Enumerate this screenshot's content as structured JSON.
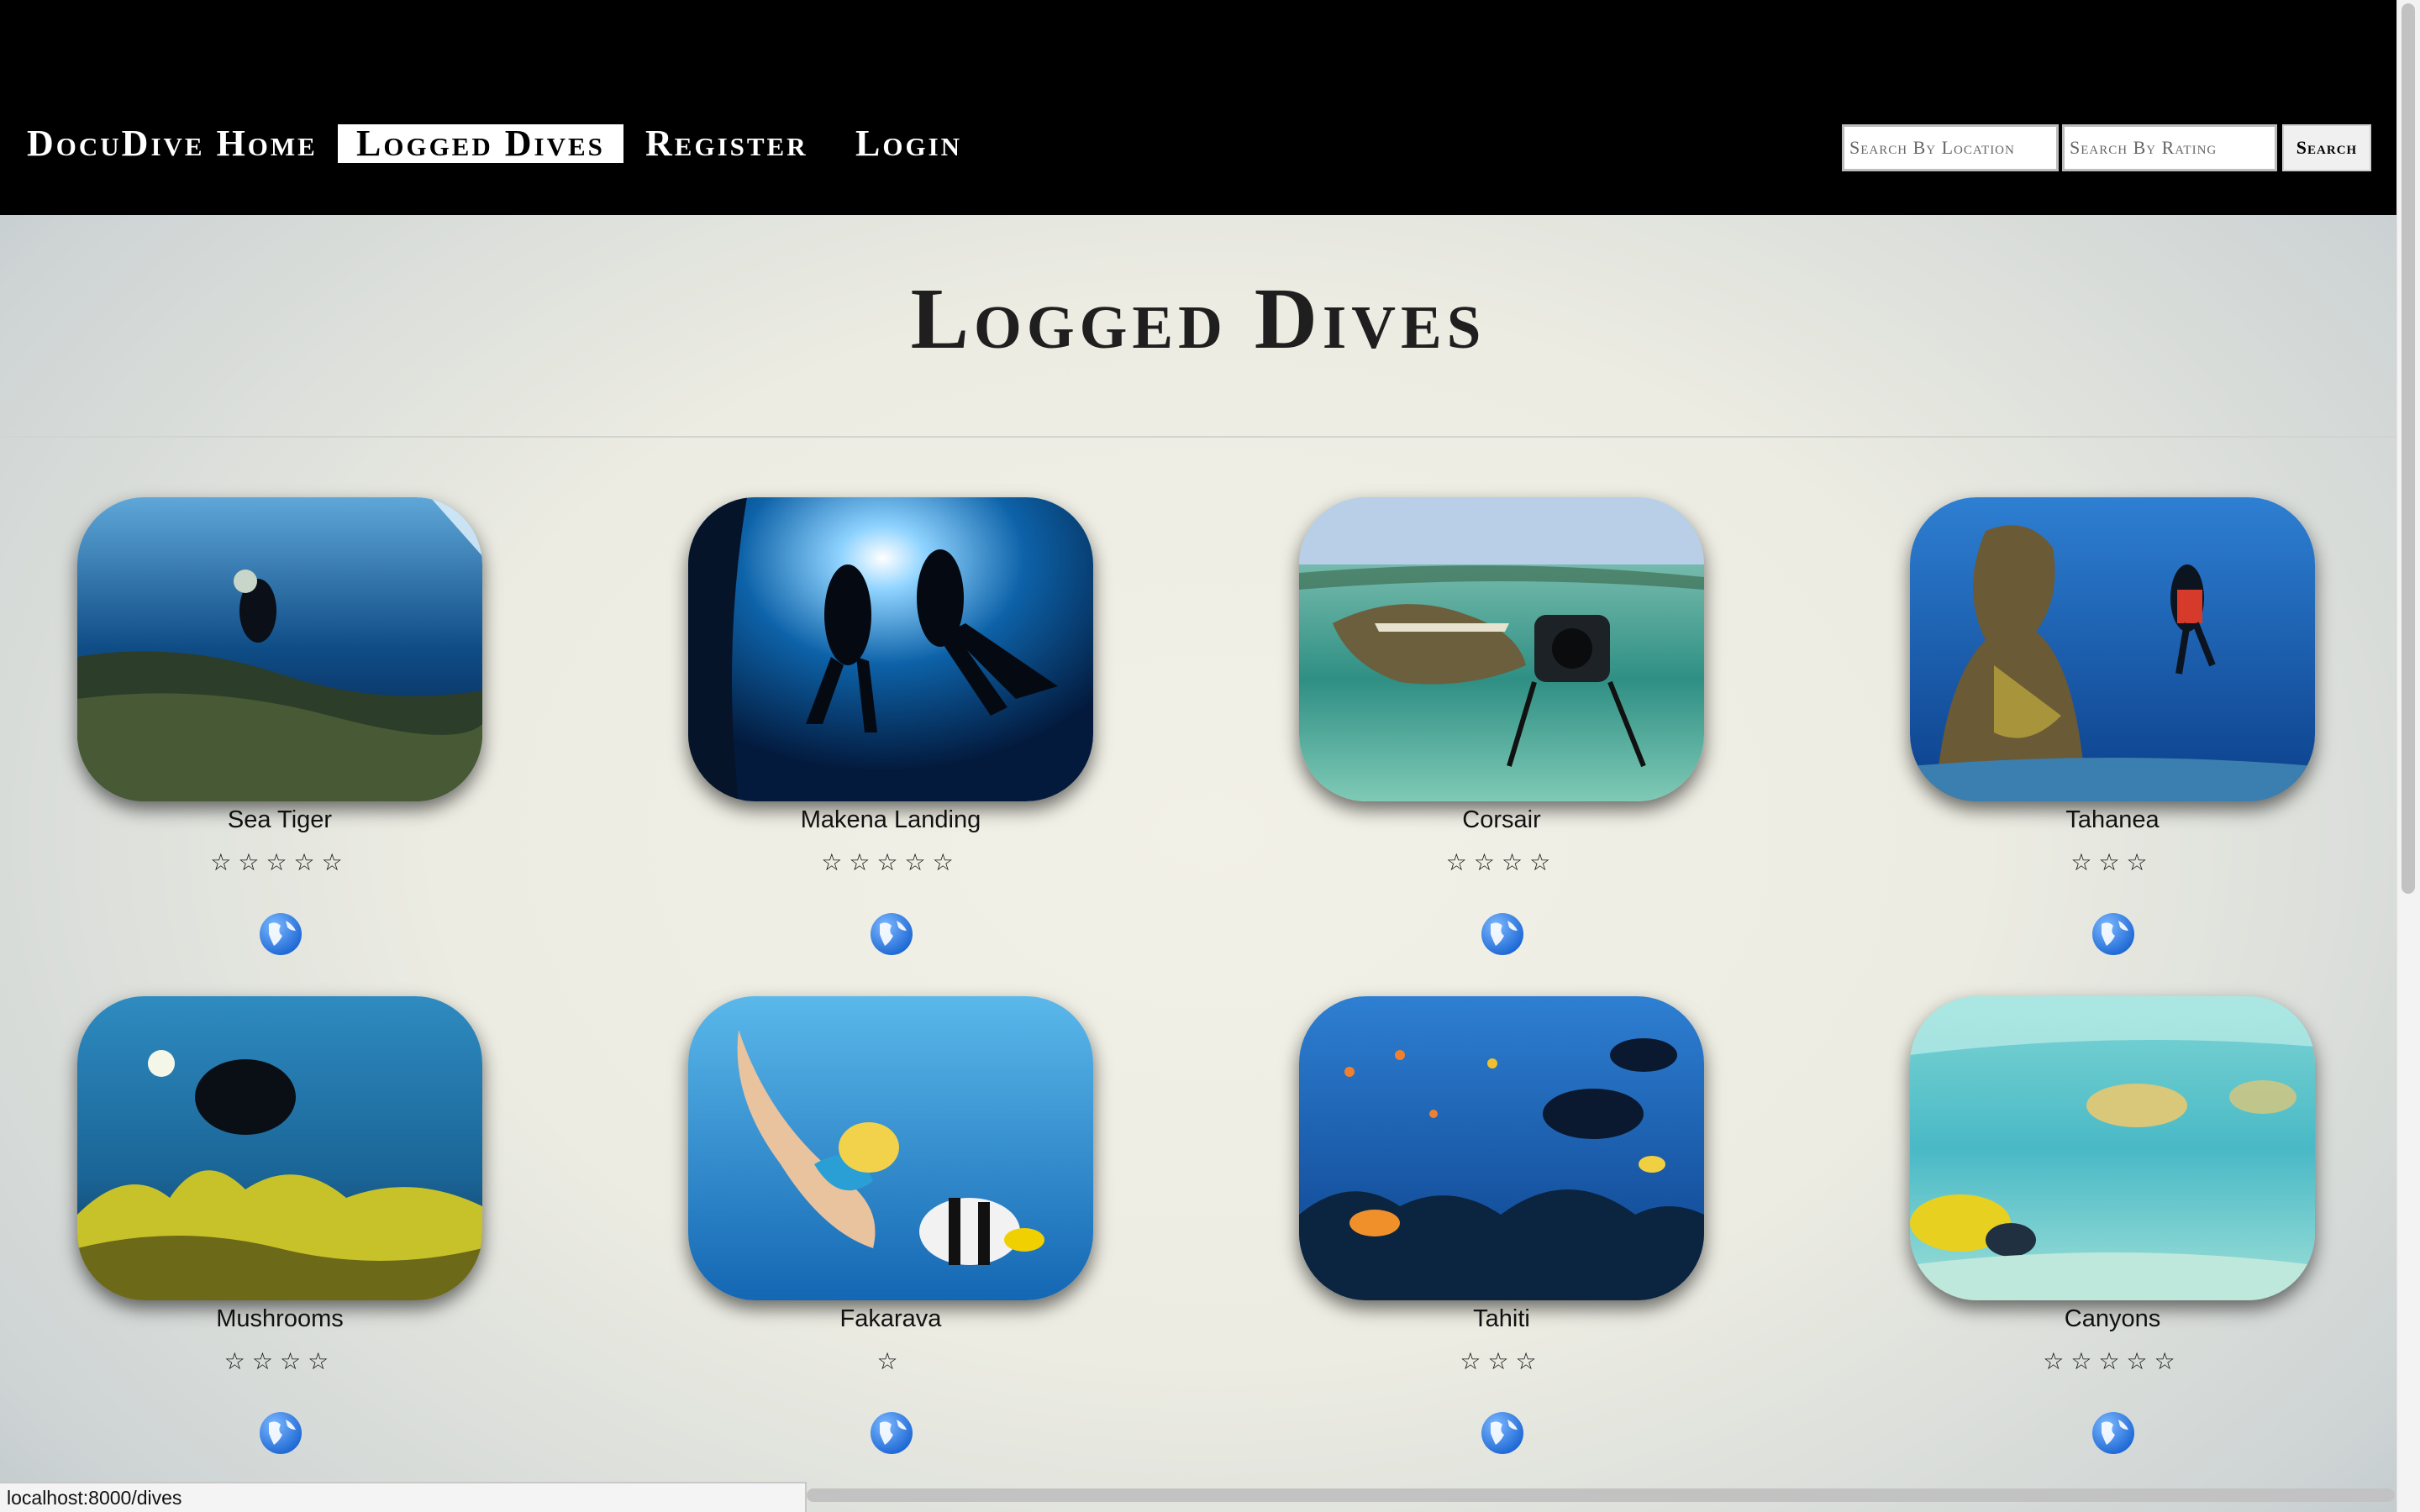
{
  "nav": {
    "links": [
      {
        "label": "DocuDive Home",
        "active": false
      },
      {
        "label": "Logged Dives",
        "active": true
      },
      {
        "label": "Register",
        "active": false
      },
      {
        "label": "Login",
        "active": false
      }
    ],
    "search_location_placeholder": "Search By Location",
    "search_rating_placeholder": "Search By Rating",
    "search_button": "Search"
  },
  "page": {
    "title": "Logged Dives"
  },
  "dives": [
    {
      "name": "Sea Tiger",
      "stars": "☆☆☆☆☆",
      "rating": 5,
      "icon": "globe-icon"
    },
    {
      "name": "Makena Landing",
      "stars": "☆☆☆☆☆",
      "rating": 5,
      "icon": "globe-icon"
    },
    {
      "name": "Corsair",
      "stars": "☆☆☆☆",
      "rating": 4,
      "icon": "globe-icon"
    },
    {
      "name": "Tahanea",
      "stars": "☆☆☆",
      "rating": 3,
      "icon": "globe-icon"
    },
    {
      "name": "Mushrooms",
      "stars": "☆☆☆☆",
      "rating": 4,
      "icon": "globe-icon"
    },
    {
      "name": "Fakarava",
      "stars": "☆",
      "rating": 1,
      "icon": "globe-icon"
    },
    {
      "name": "Tahiti",
      "stars": "☆☆☆",
      "rating": 3,
      "icon": "globe-icon"
    },
    {
      "name": "Canyons",
      "stars": "☆☆☆☆☆",
      "rating": 5,
      "icon": "globe-icon"
    }
  ],
  "status_bar": {
    "url": "localhost:8000/dives"
  },
  "colors": {
    "navbar": "#000000",
    "background": "#ecece2",
    "globe": "#2d7fe0"
  }
}
